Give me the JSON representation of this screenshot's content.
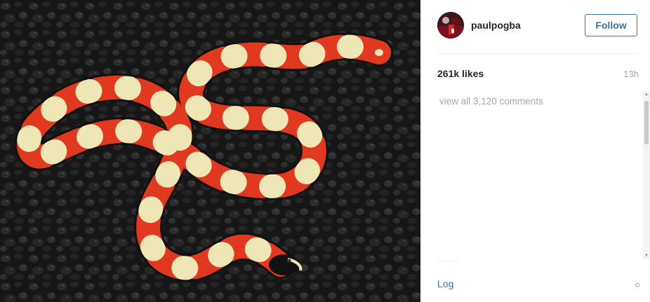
{
  "post": {
    "username": "paulpogba",
    "follow_label": "Follow",
    "likes": "261k likes",
    "time_ago": "13h",
    "view_comments": "view all 3,120 comments",
    "login_label": "Log"
  },
  "icons": {
    "avatar": "profile-avatar",
    "more": "more-options-icon",
    "scroll_up": "arrow-up-icon",
    "scroll_down": "arrow-down-icon"
  },
  "colors": {
    "accent": "#3f729b",
    "text": "#262626",
    "muted": "#a5a7aa",
    "snake_red": "#e0391f",
    "snake_black": "#111111",
    "snake_band": "#efe6b5",
    "gravel": "#202020"
  }
}
